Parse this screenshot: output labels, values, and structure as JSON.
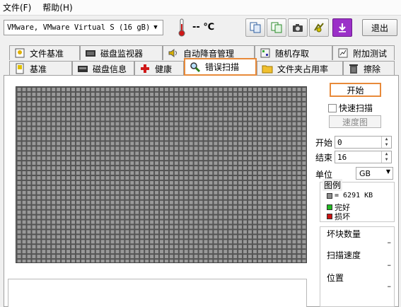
{
  "menu": {
    "file": "文件(F)",
    "help": "帮助(H)"
  },
  "toolbar": {
    "drive": "VMware, VMware Virtual S (16 gB)",
    "temperature": "-- ℃",
    "exit_label": "退出",
    "icons": [
      "copy-icon",
      "copy-report-icon",
      "camera-icon",
      "options-icon",
      "download-icon"
    ]
  },
  "tabs_row1": [
    "文件基准",
    "磁盘监视器",
    "自动降音管理",
    "随机存取",
    "附加测试"
  ],
  "tabs_row2": [
    "基准",
    "磁盘信息",
    "健康",
    "错误扫描",
    "文件夹占用率",
    "擦除"
  ],
  "scan": {
    "start_label": "开始",
    "quick_scan_label": "快速扫描",
    "speed_map_label": "速度图",
    "start_field_label": "开始",
    "start_value": "0",
    "end_field_label": "结束",
    "end_value": "16",
    "unit_label": "单位",
    "unit_value": "GB"
  },
  "legend": {
    "title": "图例",
    "block_size": "= 6291 KB",
    "ok": "完好",
    "damaged": "损坏",
    "colors": {
      "block": "#8c8c8c",
      "ok": "#22bb22",
      "damaged": "#cc1111"
    }
  },
  "stats": {
    "bad_blocks_label": "坏块数量",
    "bad_blocks_value": "–",
    "scan_speed_label": "扫描速度",
    "scan_speed_value": "–",
    "position_label": "位置",
    "position_value": "–"
  },
  "colors": {
    "accent": "#e88a3a"
  }
}
